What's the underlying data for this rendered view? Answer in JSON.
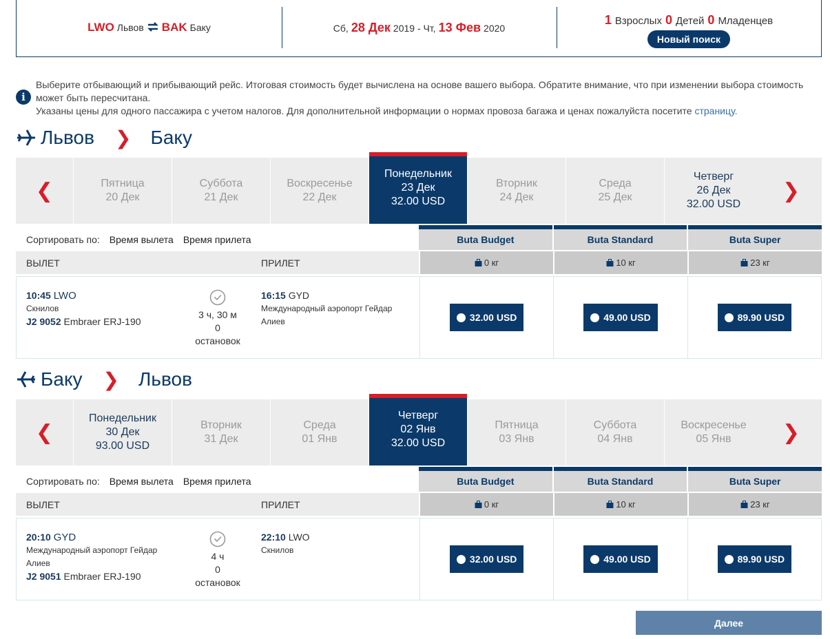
{
  "summary": {
    "origin_code": "LWO",
    "origin_city": "Львов",
    "dest_code": "BAK",
    "dest_city": "Баку",
    "dep_weekday": "Сб,",
    "dep_day": "28 Дек",
    "dep_year": "2019 - Чт,",
    "ret_day": "13 Фев",
    "ret_year": "2020",
    "adults_count": "1",
    "adults_label": "Взрослых",
    "children_count": "0",
    "children_label": "Детей",
    "infants_count": "0",
    "infants_label": "Младенцев",
    "new_search_label": "Новый поиск"
  },
  "info": {
    "line1": "Выберите отбывающий и прибывающий рейс. Итоговая стоимость будет вычислена на основе вашего выбора. Обратите внимание, что при изменении выбора стоимость может быть пересчитана.",
    "line2": "Указаны цены для одного пассажира с учетом налогов. Для дополнительной информации о нормах провоза багажа и ценах пожалуйста посетите",
    "link": "страницу."
  },
  "outbound": {
    "from": "Львов",
    "to": "Баку",
    "days": [
      {
        "weekday": "Пятница",
        "date": "20 Дек",
        "price": ""
      },
      {
        "weekday": "Суббота",
        "date": "21 Дек",
        "price": ""
      },
      {
        "weekday": "Воскресенье",
        "date": "22 Дек",
        "price": ""
      },
      {
        "weekday": "Понедельник",
        "date": "23 Дек",
        "price": "32.00 USD"
      },
      {
        "weekday": "Вторник",
        "date": "24 Дек",
        "price": ""
      },
      {
        "weekday": "Среда",
        "date": "25 Дек",
        "price": ""
      },
      {
        "weekday": "Четверг",
        "date": "26 Дек",
        "price": "32.00 USD"
      }
    ],
    "flight": {
      "dep_time": "10:45",
      "dep_code": "LWO",
      "dep_airport": "Скнилов",
      "flight_no": "J2 9052",
      "aircraft": "Embraer ERJ-190",
      "duration": "3 ч, 30 м",
      "stops_count": "0",
      "stops_label": "остановок",
      "arr_time": "16:15",
      "arr_code": "GYD",
      "arr_airport": "Международный аэропорт Гейдар Алиев",
      "fares": [
        "32.00  USD",
        "49.00  USD",
        "89.90  USD"
      ]
    }
  },
  "inbound": {
    "from": "Баку",
    "to": "Львов",
    "days": [
      {
        "weekday": "Понедельник",
        "date": "30 Дек",
        "price": "93.00 USD"
      },
      {
        "weekday": "Вторник",
        "date": "31 Дек",
        "price": ""
      },
      {
        "weekday": "Среда",
        "date": "01 Янв",
        "price": ""
      },
      {
        "weekday": "Четверг",
        "date": "02 Янв",
        "price": "32.00 USD"
      },
      {
        "weekday": "Пятница",
        "date": "03 Янв",
        "price": ""
      },
      {
        "weekday": "Суббота",
        "date": "04 Янв",
        "price": ""
      },
      {
        "weekday": "Воскресенье",
        "date": "05 Янв",
        "price": ""
      }
    ],
    "flight": {
      "dep_time": "20:10",
      "dep_code": "GYD",
      "dep_airport": "Международный аэропорт Гейдар Алиев",
      "flight_no": "J2 9051",
      "aircraft": "Embraer ERJ-190",
      "duration": "4 ч",
      "stops_count": "0",
      "stops_label": "остановок",
      "arr_time": "22:10",
      "arr_code": "LWO",
      "arr_airport": "Скнилов",
      "fares": [
        "32.00  USD",
        "49.00  USD",
        "89.90  USD"
      ]
    }
  },
  "table": {
    "sort_label": "Сортировать по:",
    "sort_dep": "Время вылета",
    "sort_arr": "Время прилета",
    "col_dep": "ВЫЛЕТ",
    "col_arr": "ПРИЛЕТ",
    "fares": [
      "Buta Budget",
      "Buta Standard",
      "Buta Super"
    ],
    "bags": [
      "0 кг",
      "10 кг",
      "23 кг"
    ]
  },
  "next_label": "Далее",
  "colors": {
    "primary": "#0b3a6a",
    "accent": "#d71e28",
    "next_button": "#5f83a8"
  }
}
